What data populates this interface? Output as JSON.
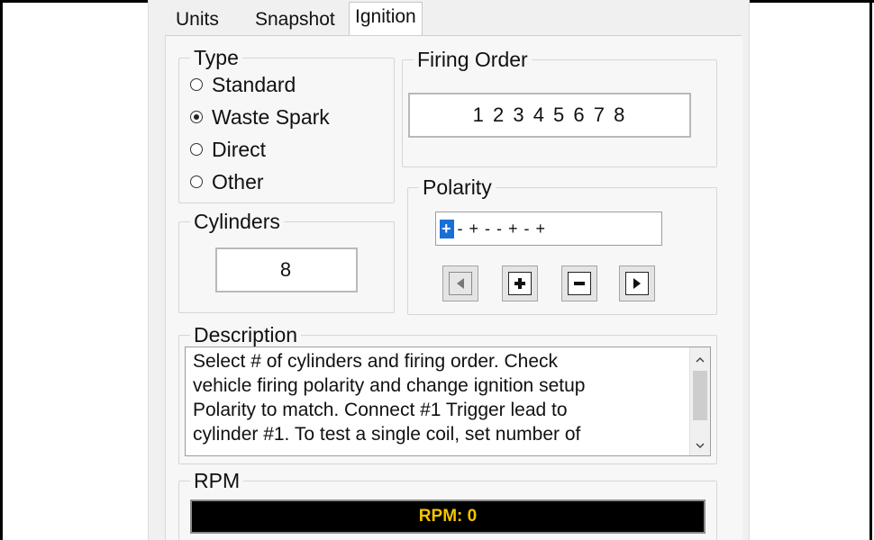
{
  "tabs": [
    {
      "label": "Units"
    },
    {
      "label": "Snapshot"
    },
    {
      "label": "Ignition"
    }
  ],
  "type_group": {
    "title": "Type",
    "options": [
      {
        "label": "Standard",
        "selected": false
      },
      {
        "label": "Waste Spark",
        "selected": true
      },
      {
        "label": "Direct",
        "selected": false
      },
      {
        "label": "Other",
        "selected": false
      }
    ]
  },
  "firing_order": {
    "title": "Firing Order",
    "value": "1 2 3 4 5 6 7 8"
  },
  "cylinders": {
    "title": "Cylinders",
    "value": "8"
  },
  "polarity": {
    "title": "Polarity",
    "selected_char": "+",
    "rest": "- + - - + - +",
    "buttons": {
      "left_icon": "left-arrow-icon",
      "plus_icon": "plus-icon",
      "minus_icon": "minus-icon",
      "right_icon": "right-arrow-icon"
    }
  },
  "description": {
    "title": "Description",
    "lines": [
      "Select # of cylinders and firing order. Check",
      "vehicle firing polarity and change ignition setup",
      "Polarity to match. Connect #1 Trigger lead to",
      "cylinder #1. To test a single coil, set number of"
    ]
  },
  "rpm": {
    "title": "RPM",
    "value": "RPM: 0",
    "color": "#f4c400"
  }
}
